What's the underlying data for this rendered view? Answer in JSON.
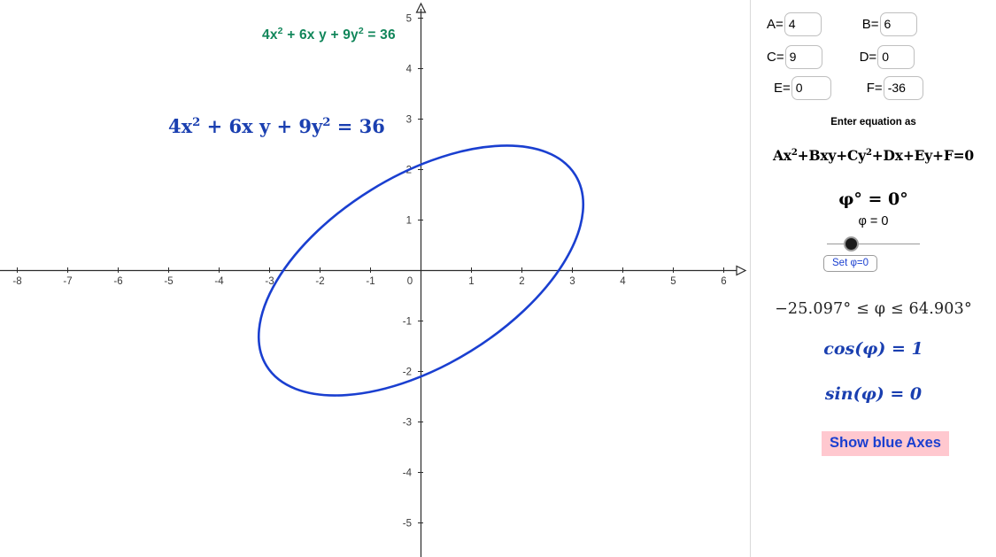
{
  "graph": {
    "equation_green": {
      "lhs_a": "4x",
      "sup1": "2",
      "mid": " + 6x y + 9y",
      "sup2": "2",
      "rhs": " = 36"
    },
    "equation_blue": {
      "lhs_a": "4x",
      "sup1": "2",
      "mid": " + 6x y + 9y",
      "sup2": "2",
      "rhs": " = 36"
    },
    "curve_color": "#1a3fd0",
    "axis_color": "#2b2b2b",
    "x_ticks": [
      "-8",
      "-7",
      "-6",
      "-5",
      "-4",
      "-3",
      "-2",
      "-1",
      "0",
      "1",
      "2",
      "3",
      "4",
      "5",
      "6"
    ],
    "y_ticks_positive": [
      "1",
      "2",
      "3",
      "4",
      "5"
    ],
    "y_ticks_negative": [
      "-1",
      "-2",
      "-3",
      "-4",
      "-5"
    ]
  },
  "panel": {
    "coefficients": [
      {
        "name": "A",
        "label": "A=",
        "value": "4"
      },
      {
        "name": "B",
        "label": "B=",
        "value": "6"
      },
      {
        "name": "C",
        "label": "C=",
        "value": "9"
      },
      {
        "name": "D",
        "label": "D=",
        "value": "0"
      },
      {
        "name": "E",
        "label": "E=",
        "value": "0"
      },
      {
        "name": "F",
        "label": "F=",
        "value": "-36"
      }
    ],
    "enter_equation_label": "Enter equation as",
    "general_equation": {
      "p1": "Ax",
      "s1": "2",
      "p2": "+Bxy+Cy",
      "s2": "2",
      "p3": "+Dx+Ey+F=0"
    },
    "phi_title": "φ° = 0°",
    "phi_value": "φ = 0",
    "set_phi_button": "Set φ=0",
    "phi_range": "−25.097° ≤ φ ≤ 64.903°",
    "cos_value": "cos(φ) = 1",
    "sin_value": "sin(φ) = 0",
    "show_axes_button": "Show blue Axes",
    "accent_blue": "#1a3fd0",
    "highlight_pink": "#ffc8cf"
  }
}
